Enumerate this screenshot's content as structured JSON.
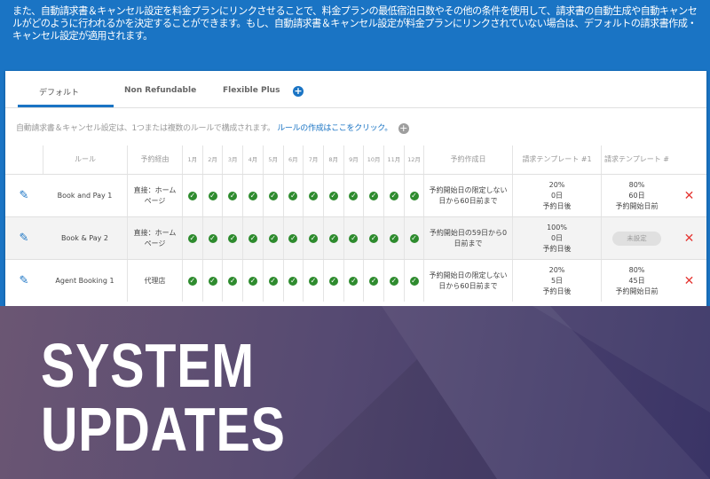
{
  "intro_text": "また、自動請求書＆キャンセル設定を料金プランにリンクさせることで、料金プランの最低宿泊日数やその他の条件を使用して、請求書の自動生成や自動キャンセルがどのように行われるかを決定することができます。もし、自動請求書＆キャンセル設定が料金プランにリンクされていない場合は、デフォルトの請求書作成・キャンセル設定が適用されます。",
  "tabs": [
    {
      "label": "デフォルト",
      "active": true
    },
    {
      "label": "Non Refundable"
    },
    {
      "label": "Flexible Plus"
    }
  ],
  "note": {
    "text": "自動請求書＆キャンセル設定は、1つまたは複数のルールで構成されます。",
    "link": "ルールの作成はここをクリック。"
  },
  "headers": {
    "rule": "ルール",
    "route": "予約経由",
    "months": [
      "1月",
      "2月",
      "3月",
      "4月",
      "5月",
      "6月",
      "7月",
      "8月",
      "9月",
      "10月",
      "11月",
      "12月"
    ],
    "created": "予約作成日",
    "template1": "請求テンプレート #1",
    "template2": "請求テンプレート #"
  },
  "rows": [
    {
      "rule": "Book and Pay 1",
      "route": "直接：ホーム\nページ",
      "created": "予約開始日の限定しない\n日から60日前まで",
      "t1": "20%\n0日\n予約日後",
      "t2": "80%\n60日\n予約開始日前",
      "t2_pill": ""
    },
    {
      "rule": "Book & Pay 2",
      "route": "直接：ホーム\nページ",
      "created": "予約開始日の59日から0\n日前まで",
      "t1": "100%\n0日\n予約日後",
      "t2": "",
      "t2_pill": "未設定"
    },
    {
      "rule": "Agent Booking 1",
      "route": "代理店",
      "created": "予約開始日の限定しない\n日から60日前まで",
      "t1": "20%\n5日\n予約日後",
      "t2": "80%\n45日\n予約開始日前",
      "t2_pill": ""
    }
  ],
  "banner": {
    "line1": "SYSTEM",
    "line2": "UPDATES"
  },
  "colors": {
    "brand_blue": "#1a74c4",
    "check_green": "#2e8b2e",
    "delete_red": "#e53935"
  }
}
